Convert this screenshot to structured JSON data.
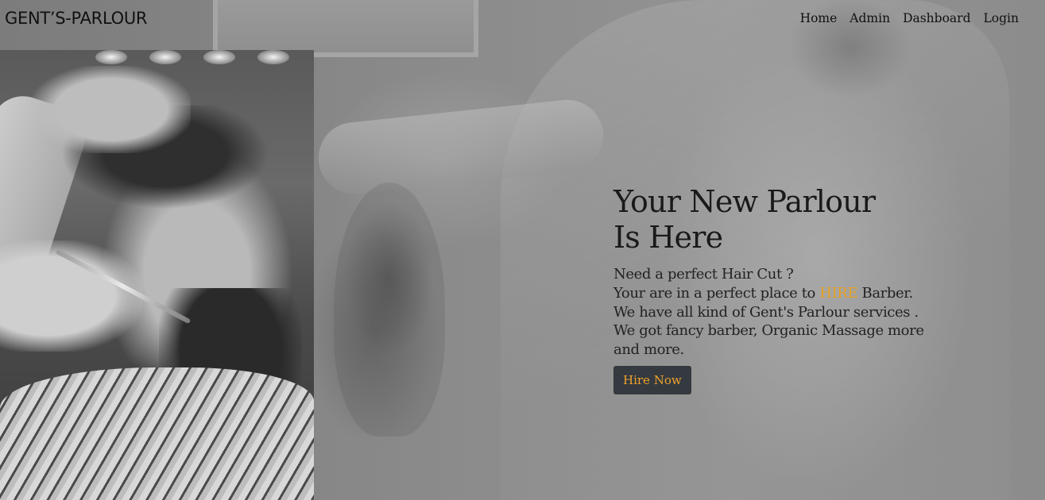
{
  "brand": "GENT’S-PARLOUR",
  "nav": {
    "items": [
      {
        "label": "Home"
      },
      {
        "label": "Admin"
      },
      {
        "label": "Dashboard"
      },
      {
        "label": "Login"
      }
    ]
  },
  "hero": {
    "title_line1": "Your New Parlour",
    "title_line2": "Is Here",
    "line1": "Need a perfect Hair Cut ?",
    "line2_before": "Your are in a perfect place to ",
    "line2_accent": "HIRE",
    "line2_after": " Barber.",
    "line3": "We have all kind of Gent's Parlour services .",
    "line4": "We got fancy barber, Organic Massage more and more.",
    "button_label": "Hire Now"
  },
  "colors": {
    "accent": "#e8a222",
    "button_bg": "#343a40",
    "button_text": "#f0a32b"
  }
}
